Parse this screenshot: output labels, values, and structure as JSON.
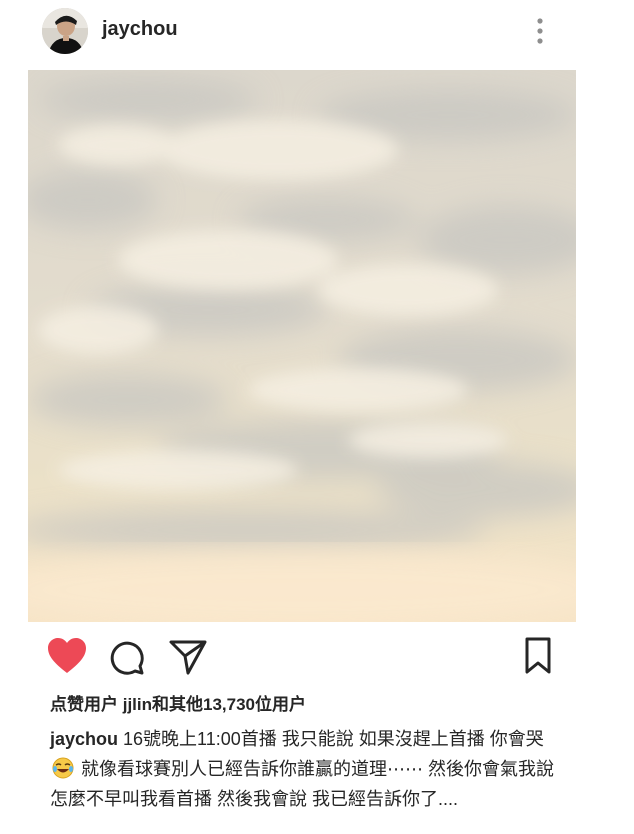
{
  "header": {
    "username": "jaychou",
    "avatar_icon": "profile-avatar",
    "more_icon": "more-options-icon"
  },
  "photo": {
    "description_icon": "sky-clouds-image",
    "colors": {
      "sky_top": "#d9d4c9",
      "sky_mid": "#e6e0d0",
      "sky_bottom": "#f4e2c4"
    }
  },
  "actions": {
    "like_icon": "heart-icon",
    "like_color": "#ed4956",
    "liked": true,
    "comment_icon": "comment-icon",
    "share_icon": "share-icon",
    "save_icon": "bookmark-icon"
  },
  "likes": {
    "prefix": "点赞用户 ",
    "user": "jjlin",
    "suffix": "和其他13,730位用户"
  },
  "caption": {
    "user": "jaychou",
    "text_part1": " 16號晚上11:00首播 我只能說 如果沒趕上首播 你會哭",
    "emoji_icon": "laughing-crying-emoji",
    "text_part2": " 就像看球賽別人已經告訴你誰贏的道理⋯⋯ 然後你會氣我說 怎麼不早叫我看首播 然後我會說 我已經告訴你了...."
  }
}
